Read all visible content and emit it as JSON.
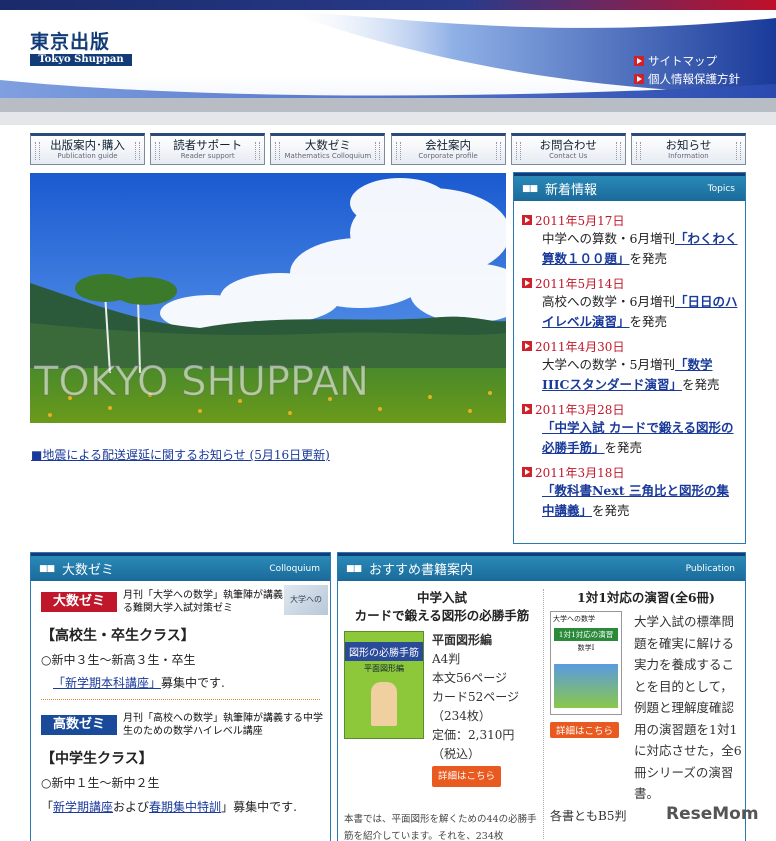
{
  "header": {
    "logo_jp": "東京出版",
    "logo_en": "Tokyo Shuppan",
    "links": [
      "サイトマップ",
      "個人情報保護方針"
    ]
  },
  "nav": [
    {
      "jp": "出版案内･購入",
      "en": "Publication guide"
    },
    {
      "jp": "読者サポート",
      "en": "Reader support"
    },
    {
      "jp": "大数ゼミ",
      "en": "Mathematics Colloquium"
    },
    {
      "jp": "会社案内",
      "en": "Corporate profile"
    },
    {
      "jp": "お問合わせ",
      "en": "Contact Us"
    },
    {
      "jp": "お知らせ",
      "en": "Information"
    }
  ],
  "hero": {
    "text": "TOKYO SHUPPAN"
  },
  "notice": "■地震による配送遅延に関するお知らせ (5月16日更新)",
  "topics": {
    "title": "新着情報",
    "subtitle": "Topics",
    "items": [
      {
        "date": "2011年5月17日",
        "pre": "中学への算数・6月増刊",
        "link": "「わくわく算数１００題」",
        "post": "を発売"
      },
      {
        "date": "2011年5月14日",
        "pre": "高校への数学・6月増刊",
        "link": "「日日のハイレベル演習」",
        "post": "を発売"
      },
      {
        "date": "2011年4月30日",
        "pre": "大学への数学・5月増刊",
        "link": "「数学IIICスタンダード演習」",
        "post": "を発売"
      },
      {
        "date": "2011年3月28日",
        "pre": "",
        "link": "「中学入試 カードで鍛える図形の必勝手筋」",
        "post": "を発売"
      },
      {
        "date": "2011年3月18日",
        "pre": "",
        "link": "「教科書Next 三角比と図形の集中講義」",
        "post": "を発売"
      }
    ]
  },
  "zemi": {
    "title": "大数ゼミ",
    "subtitle": "Colloquium",
    "thumb": "大学への",
    "tag1": "大数ゼミ",
    "desc1": "月刊「大学への数学」執筆陣が講義する難関大学入試対策ゼミ",
    "class1": "【高校生・卒生クラス】",
    "line1": "○新中３生～新高３生・卒生",
    "link1": "「新学期本科講座」",
    "after1": "募集中です.",
    "tag2": "高数ゼミ",
    "desc2": "月刊「高校への数学」執筆陣が講義する中学生のための数学ハイレベル講座",
    "class2": "【中学生クラス】",
    "line2": "○新中１生～新中２生",
    "pre3": "「",
    "link3a": "新学期講座",
    "mid3": "および",
    "link3b": "春期集中特訓",
    "after3": "」募集中です."
  },
  "books": {
    "title": "おすすめ書籍案内",
    "subtitle": "Publication",
    "b1": {
      "head1": "中学入試",
      "head2": "カードで鍛える図形の必勝手筋",
      "cover": "図形の必勝手筋",
      "cover_sub": "平面図形編",
      "details": [
        "平面図形編",
        "A4判",
        "本文56ページ",
        "カード52ページ",
        "（234枚）",
        "定価：2,310円",
        "（税込）"
      ],
      "detail": "詳細はこちら",
      "desc": "本書では、平面図形を解くための44の必勝手筋を紹介しています。それを、234枚"
    },
    "b2": {
      "head": "1対1対応の演習(全6冊)",
      "cover_top": "大学への数学",
      "cover_title": "1対1対応の演習",
      "cover_sub": "数学I",
      "detail": "詳細はこちら",
      "desc": "大学入試の標準問題を確実に解ける実力を養成することを目的として，例題と理解度確認用の演習題を1対1に対応させた，全6冊シリーズの演習書。",
      "bottom": "各書ともB5判"
    }
  },
  "watermark": "ReseMom"
}
